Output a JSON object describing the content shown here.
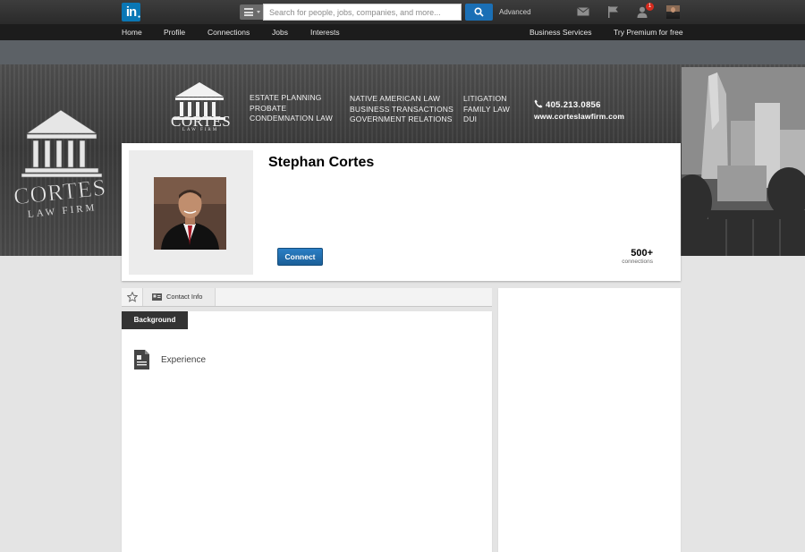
{
  "topbar": {
    "logo_text": "in",
    "search_placeholder": "Search for people, jobs, companies, and more...",
    "advanced_label": "Advanced",
    "notification_count": "1"
  },
  "nav": {
    "items": [
      "Home",
      "Profile",
      "Connections",
      "Jobs",
      "Interests"
    ],
    "right_items": [
      "Business Services",
      "Try Premium for free"
    ]
  },
  "banner": {
    "brand_name": "CORTES",
    "brand_sub": "LAW FIRM",
    "practice_col1": [
      "ESTATE PLANNING",
      "PROBATE",
      "CONDEMNATION LAW"
    ],
    "practice_col2": [
      "NATIVE AMERICAN LAW",
      "BUSINESS TRANSACTIONS",
      "GOVERNMENT RELATIONS"
    ],
    "practice_col3": [
      "LITIGATION",
      "FAMILY LAW",
      "DUI"
    ],
    "phone": "405.213.0856",
    "website": "www.corteslawfirm.com"
  },
  "profile": {
    "name": "Stephan Cortes",
    "connect_label": "Connect",
    "connections_count": "500+",
    "connections_label": "connections"
  },
  "tabs": {
    "contact_info": "Contact Info"
  },
  "background": {
    "tab_label": "Background",
    "experience_label": "Experience"
  },
  "colors": {
    "brand_blue": "#0a77b5",
    "button_blue": "#1b5f98",
    "notification_red": "#d52b1e"
  }
}
